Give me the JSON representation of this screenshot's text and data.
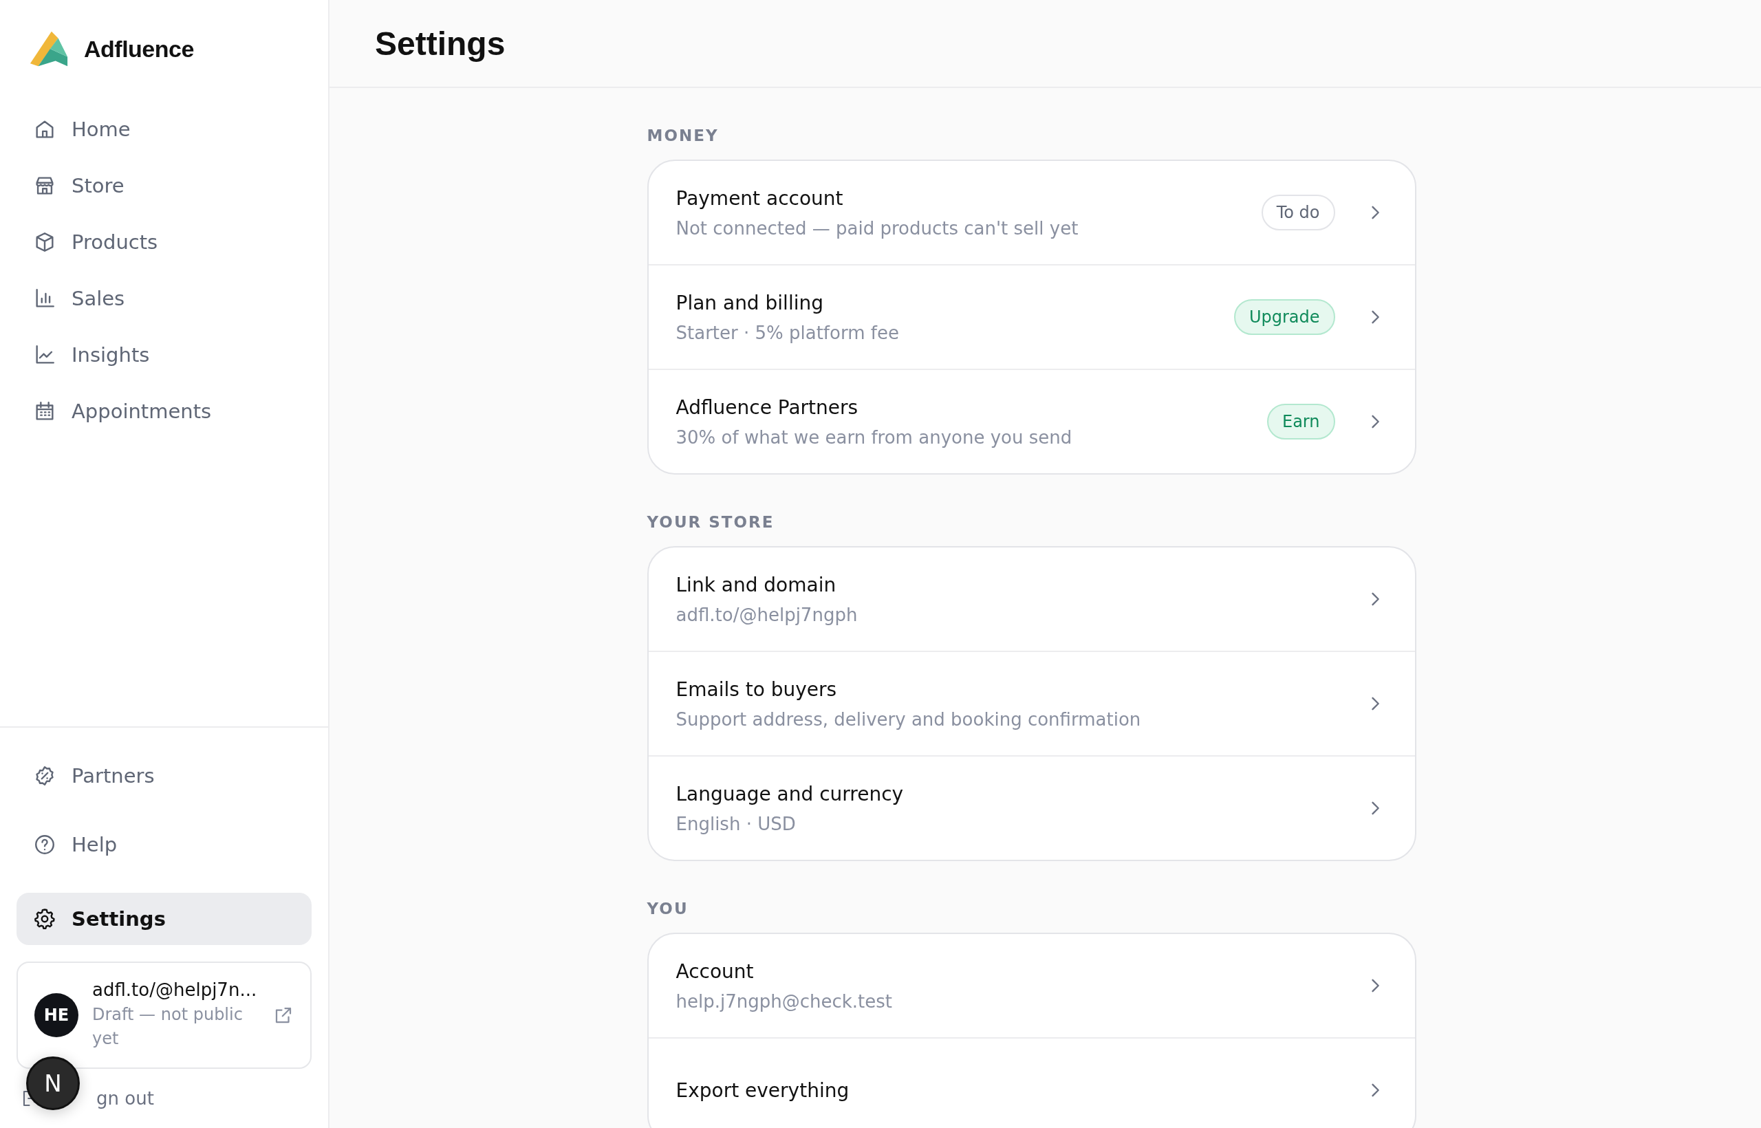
{
  "brand": {
    "name": "Adfluence"
  },
  "sidebar": {
    "items": [
      {
        "label": "Home",
        "kind": "home",
        "selected": false
      },
      {
        "label": "Store",
        "kind": "store",
        "selected": false
      },
      {
        "label": "Products",
        "kind": "box",
        "selected": false
      },
      {
        "label": "Sales",
        "kind": "bars",
        "selected": false
      },
      {
        "label": "Insights",
        "kind": "line",
        "selected": false
      },
      {
        "label": "Appointments",
        "kind": "calendar",
        "selected": false
      }
    ],
    "bottom_items": [
      {
        "label": "Partners",
        "kind": "percent",
        "selected": false
      },
      {
        "label": "Help",
        "kind": "help",
        "selected": false
      },
      {
        "label": "Settings",
        "kind": "gear",
        "selected": true
      }
    ],
    "store_card": {
      "avatar": "HE",
      "link": "adfl.to/@helpj7n...",
      "status": "Draft — not public yet"
    },
    "sign_out": "gn out",
    "dev_badge": "N"
  },
  "page": {
    "title": "Settings"
  },
  "sections": [
    {
      "heading": "MONEY",
      "rows": [
        {
          "title": "Payment account",
          "subtitle": "Not connected — paid products can't sell yet",
          "badge": {
            "text": "To do",
            "kind": "neutral"
          }
        },
        {
          "title": "Plan and billing",
          "subtitle": "Starter · 5% platform fee",
          "badge": {
            "text": "Upgrade",
            "kind": "success"
          }
        },
        {
          "title": "Adfluence Partners",
          "subtitle": "30% of what we earn from anyone you send",
          "badge": {
            "text": "Earn",
            "kind": "success"
          }
        }
      ]
    },
    {
      "heading": "YOUR STORE",
      "rows": [
        {
          "title": "Link and domain",
          "subtitle": "adfl.to/@helpj7ngph"
        },
        {
          "title": "Emails to buyers",
          "subtitle": "Support address, delivery and booking confirmation"
        },
        {
          "title": "Language and currency",
          "subtitle": "English · USD"
        }
      ]
    },
    {
      "heading": "YOU",
      "rows": [
        {
          "title": "Account",
          "subtitle": "help.j7ngph@check.test"
        },
        {
          "title": "Export everything"
        }
      ]
    }
  ]
}
